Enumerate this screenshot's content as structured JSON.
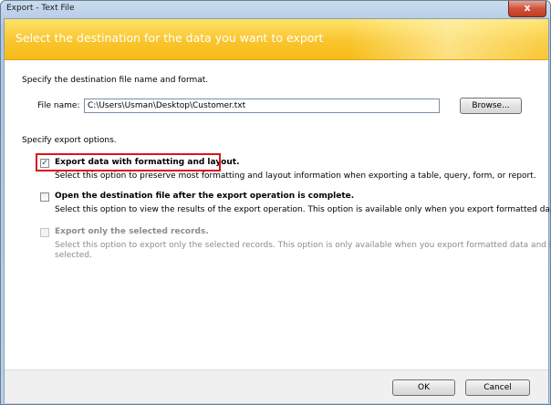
{
  "window": {
    "title": "Export - Text File",
    "close_label": "x"
  },
  "banner": {
    "headline": "Select the destination for the data you want to export"
  },
  "destination": {
    "instruction": "Specify the destination file name and format.",
    "file_label": "File name:",
    "file_value": "C:\\Users\\Usman\\Desktop\\Customer.txt",
    "browse_label": "Browse..."
  },
  "options": {
    "heading": "Specify export options.",
    "items": [
      {
        "title": "Export data with formatting and layout.",
        "description": "Select this option to preserve most formatting and layout information when exporting a table, query, form, or report.",
        "checked": true,
        "enabled": true
      },
      {
        "title": "Open the destination file after the export operation is complete.",
        "description": "Select this option to view the results of the export operation. This option is available only when you export formatted data.",
        "checked": false,
        "enabled": true
      },
      {
        "title": "Export only the selected records.",
        "description_line1": "Select this option to export only the selected records. This option is only available when you export formatted data and have records",
        "description_line2": "selected.",
        "checked": false,
        "enabled": false
      }
    ]
  },
  "footer": {
    "ok_label": "OK",
    "cancel_label": "Cancel"
  },
  "icons": {
    "checkmark": "✓"
  },
  "colors": {
    "highlight": "#d9151d",
    "banner": "#f9c52d"
  }
}
